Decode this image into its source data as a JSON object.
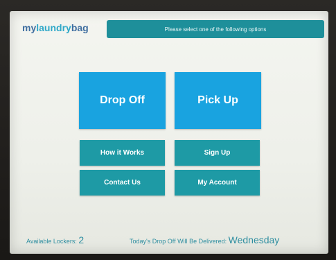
{
  "logo": {
    "part1": "my",
    "part2": "laundry",
    "part3": "bag"
  },
  "banner": {
    "text": "Please select one of the following options"
  },
  "buttons": {
    "drop_off": "Drop Off",
    "pick_up": "Pick Up",
    "how_it_works": "How it Works",
    "sign_up": "Sign Up",
    "contact_us": "Contact Us",
    "my_account": "My Account"
  },
  "footer": {
    "lockers_label": "Available Lockers:",
    "lockers_count": "2",
    "delivery_label": "Today's Drop Off Will Be Delivered:",
    "delivery_day": "Wednesday"
  },
  "colors": {
    "primary_button": "#19a3e0",
    "secondary_button": "#1e9aa5",
    "banner": "#1e8f9a"
  }
}
